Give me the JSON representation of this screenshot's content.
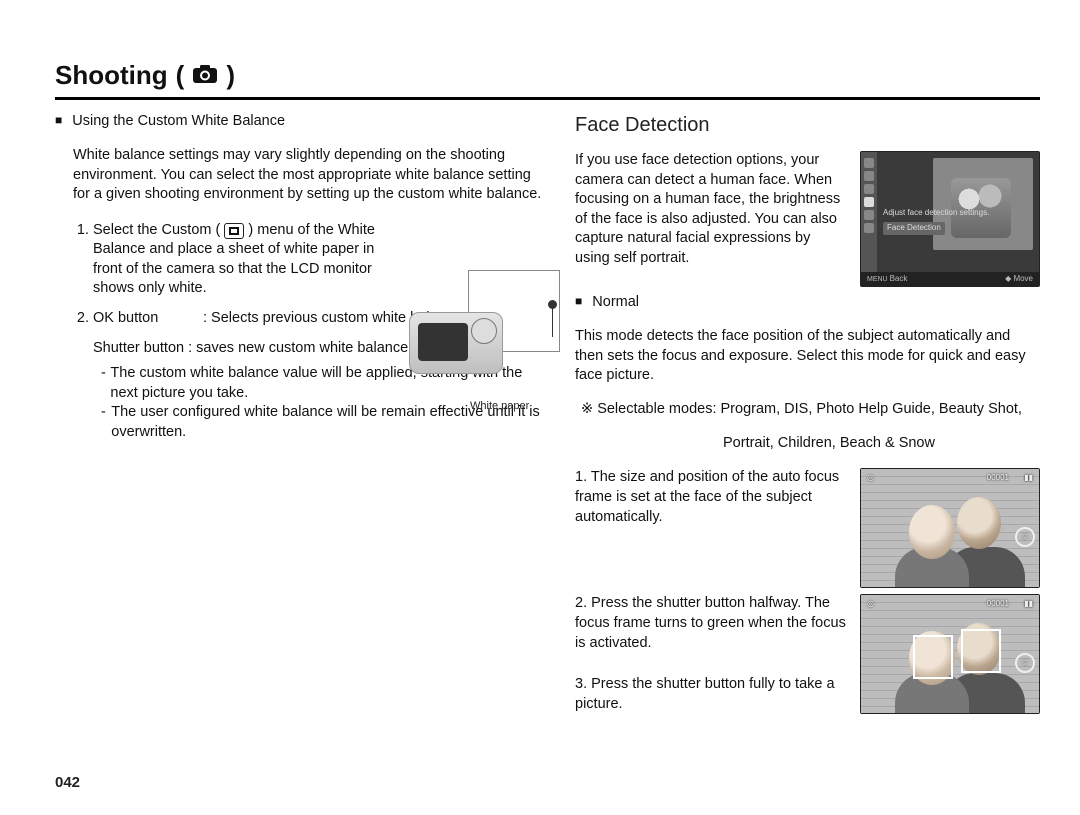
{
  "page_number": "042",
  "page_title": "Shooting",
  "left": {
    "heading": "Using the Custom White Balance",
    "intro": "White balance settings may vary slightly depending on the shooting environment. You can select the most appropriate white balance setting for a given shooting environment by setting up the custom white balance.",
    "step1": "Select the Custom ( ■ ) menu of the White Balance and place a sheet of white paper in front of the camera so that the LCD monitor shows only white.",
    "step2_label": "OK button",
    "step2_val": ": Selects previous custom white balance.",
    "step2b_label": "Shutter button",
    "step2b_val": ": saves new custom white balance.",
    "note1": "The custom white balance value will be applied, starting with the next picture you take.",
    "note2": "The user configured white balance will be remain effective until it is overwritten.",
    "fig_caption": "White paper"
  },
  "right": {
    "heading": "Face Detection",
    "intro": "If you use face detection options, your camera can detect a human face. When focusing on a human face, the brightness of the face is also adjusted. You can also capture natural facial expressions by using self portrait.",
    "menu_line1": "Adjust face detection settings.",
    "menu_line2": "Face Detection",
    "menu_back": "Back",
    "menu_move": "Move",
    "normal_label": "Normal",
    "normal_desc": "This mode detects the face position of the subject automatically and then sets the focus and exposure. Select this mode for quick and easy face picture.",
    "selectable1": "Selectable modes: Program, DIS, Photo Help Guide, Beauty Shot,",
    "selectable2": "Portrait, Children, Beach & Snow",
    "step1": "The size and position of the auto focus frame is set at the face of the subject automatically.",
    "step2": "Press the shutter button halfway. The focus frame turns to green when the focus is activated.",
    "step3": "Press the shutter button fully to take a picture.",
    "osd_count": "00001"
  }
}
